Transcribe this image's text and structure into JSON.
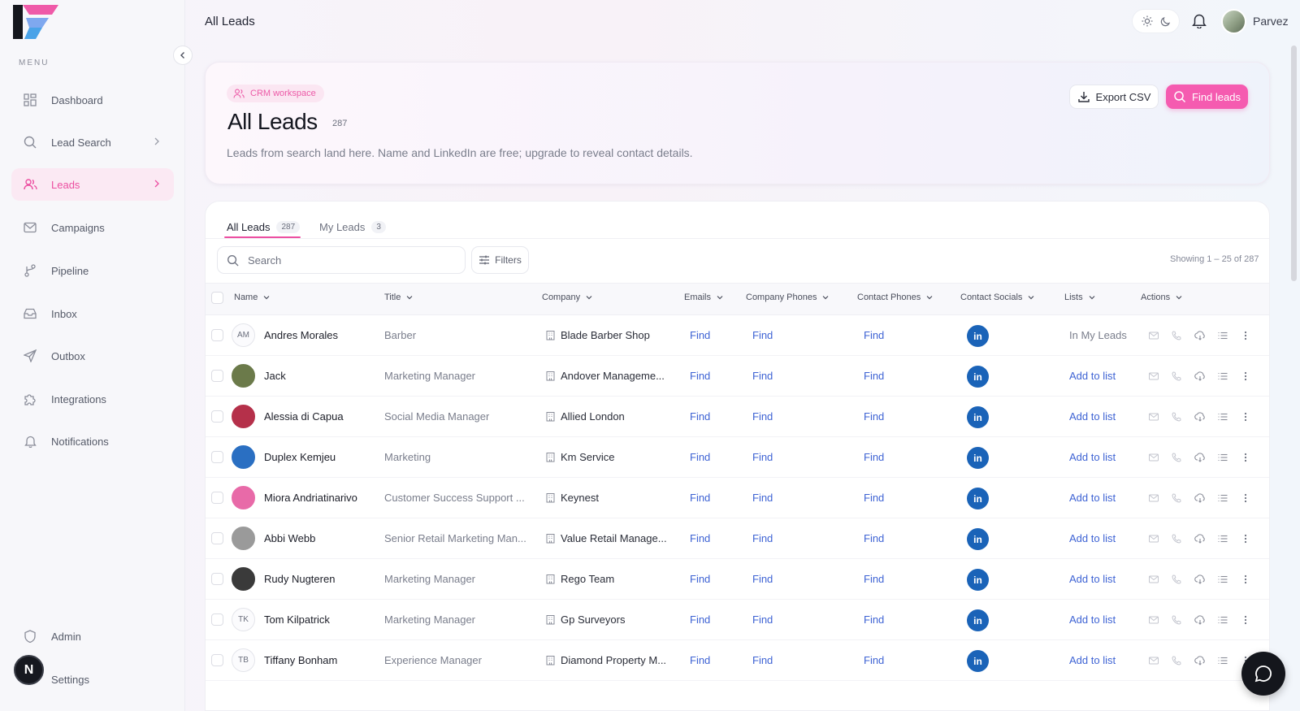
{
  "app": {
    "page_title": "All Leads"
  },
  "sidebar": {
    "menu_label": "MENU",
    "items": [
      {
        "label": "Dashboard",
        "icon": "grid-icon"
      },
      {
        "label": "Lead Search",
        "icon": "search-icon"
      },
      {
        "label": "Leads",
        "icon": "users-icon",
        "active": true
      },
      {
        "label": "Campaigns",
        "icon": "mail-icon"
      },
      {
        "label": "Pipeline",
        "icon": "branch-icon"
      },
      {
        "label": "Inbox",
        "icon": "inbox-icon"
      },
      {
        "label": "Outbox",
        "icon": "send-icon"
      },
      {
        "label": "Integrations",
        "icon": "puzzle-icon"
      },
      {
        "label": "Notifications",
        "icon": "bell-icon"
      },
      {
        "label": "Admin",
        "icon": "shield-icon"
      },
      {
        "label": "Settings",
        "icon": "gear-icon"
      }
    ],
    "user_initial": "N"
  },
  "topbar": {
    "user_name": "Parvez"
  },
  "header": {
    "badge": "CRM workspace",
    "title": "All Leads",
    "count": "287",
    "subtitle": "Leads from search land here. Name and LinkedIn are free; upgrade to reveal contact details.",
    "export_label": "Export CSV",
    "find_label": "Find leads"
  },
  "tabs": [
    {
      "label": "All Leads",
      "count": "287"
    },
    {
      "label": "My Leads",
      "count": "3"
    }
  ],
  "toolbar": {
    "search_placeholder": "Search",
    "filters_label": "Filters",
    "showing": "Showing 1 – 25 of 287"
  },
  "table": {
    "columns": [
      "Name",
      "Title",
      "Company",
      "Emails",
      "Company Phones",
      "Contact Phones",
      "Contact Socials",
      "Lists",
      "Actions"
    ],
    "rows": [
      {
        "initials": "AM",
        "name": "Andres Morales",
        "title": "Barber",
        "company": "Blade Barber Shop",
        "emails": "Find",
        "company_phones": "Find",
        "contact_phones": "Find",
        "list": "In My Leads",
        "avatar_color": ""
      },
      {
        "initials": "",
        "name": "Jack",
        "title": "Marketing Manager",
        "company": "Andover Manageme...",
        "emails": "Find",
        "company_phones": "Find",
        "contact_phones": "Find",
        "list": "Add to list",
        "avatar_color": "#6b7a4a"
      },
      {
        "initials": "",
        "name": "Alessia di Capua",
        "title": "Social Media Manager",
        "company": "Allied London",
        "emails": "Find",
        "company_phones": "Find",
        "contact_phones": "Find",
        "list": "Add to list",
        "avatar_color": "#b5304a"
      },
      {
        "initials": "",
        "name": "Duplex Kemjeu",
        "title": "Marketing",
        "company": "Km Service",
        "emails": "Find",
        "company_phones": "Find",
        "contact_phones": "Find",
        "list": "Add to list",
        "avatar_color": "#2a6fc2"
      },
      {
        "initials": "",
        "name": "Miora Andriatinarivo",
        "title": "Customer Success Support ...",
        "company": "Keynest",
        "emails": "Find",
        "company_phones": "Find",
        "contact_phones": "Find",
        "list": "Add to list",
        "avatar_color": "#e86aa8"
      },
      {
        "initials": "",
        "name": "Abbi Webb",
        "title": "Senior Retail Marketing Man...",
        "company": "Value Retail Manage...",
        "emails": "Find",
        "company_phones": "Find",
        "contact_phones": "Find",
        "list": "Add to list",
        "avatar_color": "#9a9a9a"
      },
      {
        "initials": "",
        "name": "Rudy Nugteren",
        "title": "Marketing Manager",
        "company": "Rego Team",
        "emails": "Find",
        "company_phones": "Find",
        "contact_phones": "Find",
        "list": "Add to list",
        "avatar_color": "#3a3a3a"
      },
      {
        "initials": "TK",
        "name": "Tom Kilpatrick",
        "title": "Marketing Manager",
        "company": "Gp Surveyors",
        "emails": "Find",
        "company_phones": "Find",
        "contact_phones": "Find",
        "list": "Add to list",
        "avatar_color": ""
      },
      {
        "initials": "TB",
        "name": "Tiffany Bonham",
        "title": "Experience Manager",
        "company": "Diamond Property M...",
        "emails": "Find",
        "company_phones": "Find",
        "contact_phones": "Find",
        "list": "Add to list",
        "avatar_color": ""
      }
    ]
  },
  "colors": {
    "accent": "#ec4fa1",
    "link": "#3e63d4",
    "linkedin": "#1a63b8"
  }
}
